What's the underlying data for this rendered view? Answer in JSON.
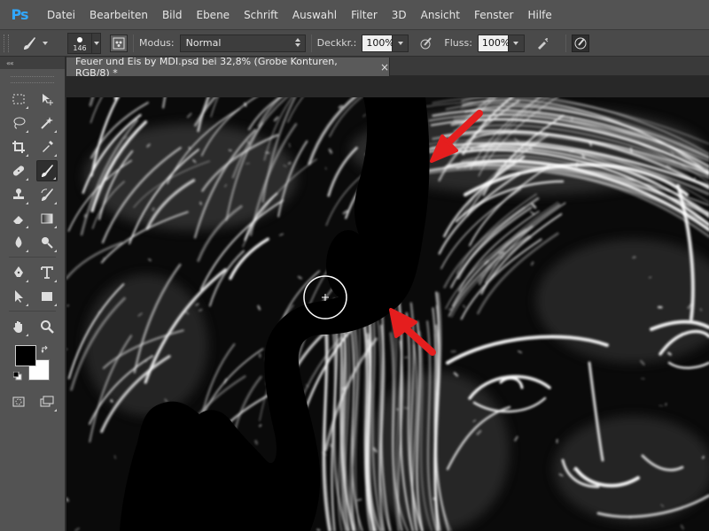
{
  "app": {
    "logo": "Ps"
  },
  "menu": [
    "Datei",
    "Bearbeiten",
    "Bild",
    "Ebene",
    "Schrift",
    "Auswahl",
    "Filter",
    "3D",
    "Ansicht",
    "Fenster",
    "Hilfe"
  ],
  "options": {
    "brush_size": "146",
    "mode_label": "Modus:",
    "mode_value": "Normal",
    "opacity_label": "Deckkr.:",
    "opacity_value": "100%",
    "flow_label": "Fluss:",
    "flow_value": "100%"
  },
  "toolbar": {
    "collapse": "««",
    "foreground_color": "#000000",
    "background_color": "#ffffff",
    "active_tool": "brush-tool"
  },
  "document": {
    "tab_title": "Feuer und Eis by MDI.psd bei 32,8% (Grobe Konturen, RGB/8) *",
    "close_label": "×"
  },
  "canvas": {
    "annotation_arrow_color": "#e51e1e",
    "arrow_count": 2
  }
}
